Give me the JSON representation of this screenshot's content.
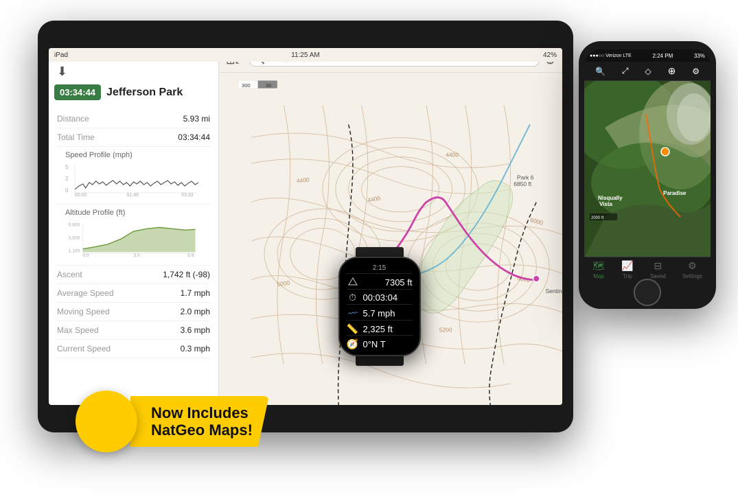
{
  "ipad": {
    "status": {
      "device": "iPad",
      "wifi": "●",
      "time": "11:25 AM",
      "battery": "42%"
    },
    "panel": {
      "time_badge": "03:34:44",
      "track_name": "Jefferson Park",
      "stats": [
        {
          "label": "Distance",
          "value": "5.93 mi"
        },
        {
          "label": "Total Time",
          "value": "03:34:44"
        }
      ],
      "speed_profile_title": "Speed Profile (mph)",
      "speed_y_labels": [
        "5",
        "2",
        "0"
      ],
      "speed_x_labels": [
        "00:00",
        "01:46",
        "03:33"
      ],
      "altitude_profile_title": "Altitude Profile (ft)",
      "altitude_y_labels": [
        "5,900",
        "3,500",
        "1,100"
      ],
      "altitude_x_labels": [
        "0.0",
        "3.0",
        "5.9"
      ],
      "extra_stats": [
        {
          "label": "Ascent",
          "value": "1,742 ft (-98)"
        },
        {
          "label": "Average Speed",
          "value": "1.7 mph"
        },
        {
          "label": "Moving Speed",
          "value": "2.0 mph"
        },
        {
          "label": "Max Speed",
          "value": "3.6 mph"
        },
        {
          "label": "Current Speed",
          "value": "0.3 mph"
        }
      ]
    },
    "map": {
      "search_placeholder": "Parks, trails, and addresses",
      "scale": "300 | 30"
    }
  },
  "watch": {
    "time": "2:15",
    "rows": [
      {
        "icon": "⛰",
        "value": "7305 ft"
      },
      {
        "icon": "⏱",
        "value": "00:03:04"
      },
      {
        "icon": "〰",
        "value": "5.7 mph"
      },
      {
        "icon": "📏",
        "value": "2,325 ft"
      },
      {
        "icon": "🧭",
        "value": "0°N T"
      }
    ]
  },
  "iphone": {
    "status": {
      "carrier": "●●●○○ Verizon LTE",
      "time": "2:24 PM",
      "battery": "33%"
    },
    "tabs": [
      {
        "label": "Map",
        "icon": "🗺",
        "active": true
      },
      {
        "label": "Trip",
        "icon": "📈",
        "active": false
      },
      {
        "label": "Saved",
        "icon": "⊟",
        "active": false
      },
      {
        "label": "Settings",
        "icon": "⚙",
        "active": false
      }
    ],
    "scale": "2000 ft"
  },
  "natgeo": {
    "line1": "Now Includes",
    "line2": "NatGeo Maps!"
  }
}
